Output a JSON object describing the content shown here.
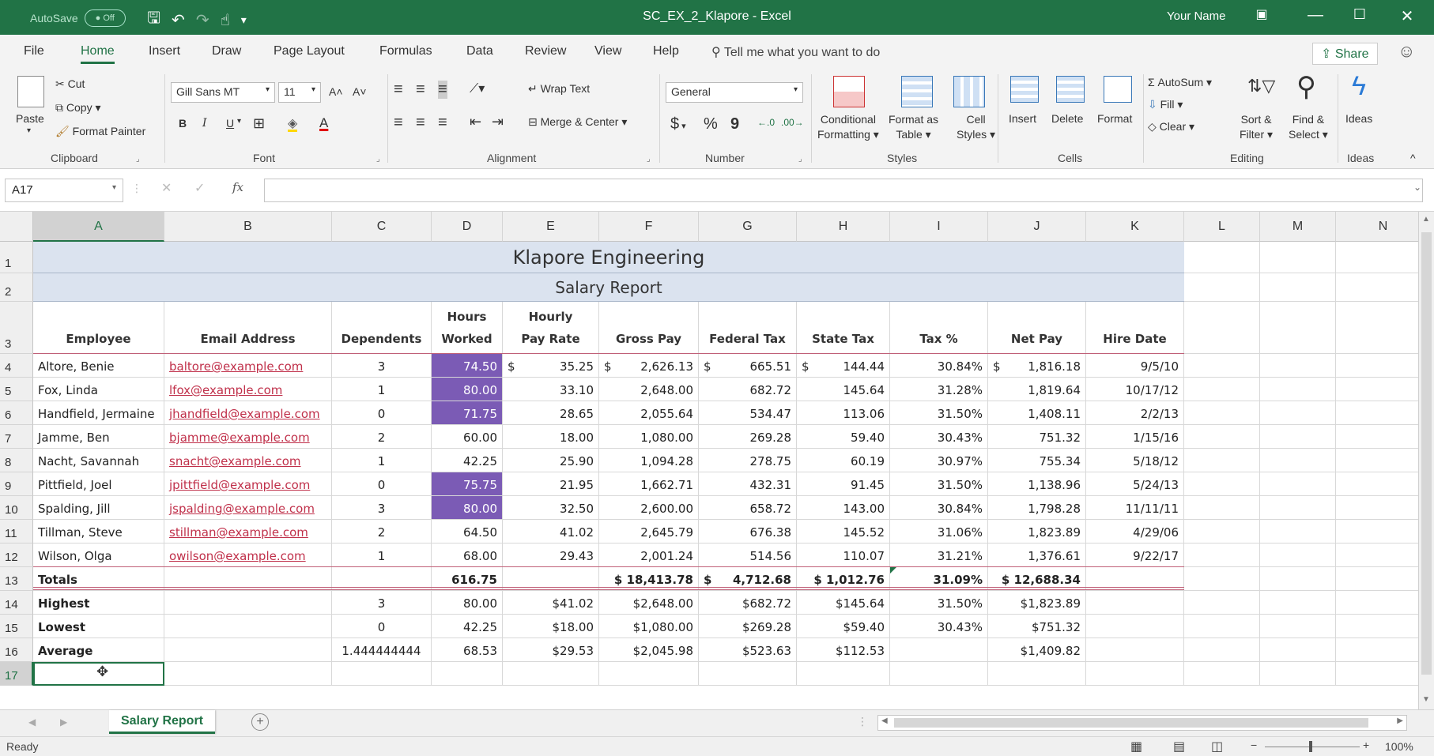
{
  "window": {
    "autosave_label": "AutoSave",
    "autosave_state": "Off",
    "title": "SC_EX_2_Klapore - Excel",
    "user": "Your Name"
  },
  "menu": [
    "File",
    "Home",
    "Insert",
    "Draw",
    "Page Layout",
    "Formulas",
    "Data",
    "Review",
    "View",
    "Help"
  ],
  "tell_me": "Tell me what you want to do",
  "share": "Share",
  "ribbon": {
    "clipboard": {
      "paste": "Paste",
      "cut": "Cut",
      "copy": "Copy",
      "format_painter": "Format Painter",
      "group": "Clipboard"
    },
    "font": {
      "name": "Gill Sans MT",
      "size": "11",
      "group": "Font",
      "bold": "B",
      "italic": "I",
      "underline": "U"
    },
    "alignment": {
      "wrap": "Wrap Text",
      "merge": "Merge & Center",
      "group": "Alignment"
    },
    "number": {
      "format": "General",
      "group": "Number",
      "dollar": "$",
      "percent": "%",
      "comma": "9"
    },
    "styles": {
      "conditional": "Conditional",
      "formatting": "Formatting",
      "format_as": "Format as",
      "table": "Table",
      "cell": "Cell",
      "cell_styles": "Styles",
      "group": "Styles"
    },
    "cells": {
      "insert": "Insert",
      "delete": "Delete",
      "format": "Format",
      "group": "Cells"
    },
    "editing": {
      "autosum": "AutoSum",
      "fill": "Fill",
      "clear": "Clear",
      "sort": "Sort &",
      "filter": "Filter",
      "find": "Find &",
      "select": "Select",
      "group": "Editing"
    },
    "ideas": {
      "label": "Ideas",
      "group": "Ideas"
    }
  },
  "namebox": "A17",
  "fx": "fx",
  "columns": [
    "A",
    "B",
    "C",
    "D",
    "E",
    "F",
    "G",
    "H",
    "I",
    "J",
    "K",
    "L",
    "M",
    "N"
  ],
  "rows": [
    "1",
    "2",
    "3",
    "4",
    "5",
    "6",
    "7",
    "8",
    "9",
    "10",
    "11",
    "12",
    "13",
    "14",
    "15",
    "16",
    "17"
  ],
  "sheet": {
    "title": "Klapore Engineering",
    "subtitle": "Salary Report",
    "headers": [
      [
        "Employee"
      ],
      [
        "Email Address"
      ],
      [
        "Dependents"
      ],
      [
        "Hours",
        "Worked"
      ],
      [
        "Hourly",
        "Pay Rate"
      ],
      [
        "Gross Pay"
      ],
      [
        "Federal Tax"
      ],
      [
        "State Tax"
      ],
      [
        "Tax %"
      ],
      [
        "Net Pay"
      ],
      [
        "Hire Date"
      ]
    ],
    "employees": [
      {
        "name": "Altore, Benie",
        "email": "baltore@example.com",
        "dep": "3",
        "hours": "74.50",
        "rate": "35.25",
        "gross": "2,626.13",
        "fed": "665.51",
        "state": "144.44",
        "taxpct": "30.84%",
        "net": "1,816.18",
        "hire": "9/5/10",
        "hi": true,
        "dollar": true
      },
      {
        "name": "Fox, Linda",
        "email": "lfox@example.com",
        "dep": "1",
        "hours": "80.00",
        "rate": "33.10",
        "gross": "2,648.00",
        "fed": "682.72",
        "state": "145.64",
        "taxpct": "31.28%",
        "net": "1,819.64",
        "hire": "10/17/12",
        "hi": true
      },
      {
        "name": "Handfield, Jermaine",
        "email": "jhandfield@example.com",
        "dep": "0",
        "hours": "71.75",
        "rate": "28.65",
        "gross": "2,055.64",
        "fed": "534.47",
        "state": "113.06",
        "taxpct": "31.50%",
        "net": "1,408.11",
        "hire": "2/2/13",
        "hi": true
      },
      {
        "name": "Jamme, Ben",
        "email": "bjamme@example.com",
        "dep": "2",
        "hours": "60.00",
        "rate": "18.00",
        "gross": "1,080.00",
        "fed": "269.28",
        "state": "59.40",
        "taxpct": "30.43%",
        "net": "751.32",
        "hire": "1/15/16",
        "hi": false
      },
      {
        "name": "Nacht, Savannah",
        "email": "snacht@example.com",
        "dep": "1",
        "hours": "42.25",
        "rate": "25.90",
        "gross": "1,094.28",
        "fed": "278.75",
        "state": "60.19",
        "taxpct": "30.97%",
        "net": "755.34",
        "hire": "5/18/12",
        "hi": false
      },
      {
        "name": "Pittfield, Joel",
        "email": "jpittfield@example.com",
        "dep": "0",
        "hours": "75.75",
        "rate": "21.95",
        "gross": "1,662.71",
        "fed": "432.31",
        "state": "91.45",
        "taxpct": "31.50%",
        "net": "1,138.96",
        "hire": "5/24/13",
        "hi": true
      },
      {
        "name": "Spalding, Jill",
        "email": "jspalding@example.com",
        "dep": "3",
        "hours": "80.00",
        "rate": "32.50",
        "gross": "2,600.00",
        "fed": "658.72",
        "state": "143.00",
        "taxpct": "30.84%",
        "net": "1,798.28",
        "hire": "11/11/11",
        "hi": true
      },
      {
        "name": "Tillman, Steve",
        "email": "stillman@example.com",
        "dep": "2",
        "hours": "64.50",
        "rate": "41.02",
        "gross": "2,645.79",
        "fed": "676.38",
        "state": "145.52",
        "taxpct": "31.06%",
        "net": "1,823.89",
        "hire": "4/29/06",
        "hi": false
      },
      {
        "name": "Wilson, Olga",
        "email": "owilson@example.com",
        "dep": "1",
        "hours": "68.00",
        "rate": "29.43",
        "gross": "2,001.24",
        "fed": "514.56",
        "state": "110.07",
        "taxpct": "31.21%",
        "net": "1,376.61",
        "hire": "9/22/17",
        "hi": false
      }
    ],
    "dollar_sign": "$",
    "totals": {
      "label": "Totals",
      "hours": "616.75",
      "gross": "$ 18,413.78",
      "fed": "4,712.68",
      "state": "$ 1,012.76",
      "taxpct": "31.09%",
      "net": "$ 12,688.34"
    },
    "highest": {
      "label": "Highest",
      "dep": "3",
      "hours": "80.00",
      "rate": "$41.02",
      "gross": "$2,648.00",
      "fed": "$682.72",
      "state": "$145.64",
      "taxpct": "31.50%",
      "net": "$1,823.89"
    },
    "lowest": {
      "label": "Lowest",
      "dep": "0",
      "hours": "42.25",
      "rate": "$18.00",
      "gross": "$1,080.00",
      "fed": "$269.28",
      "state": "$59.40",
      "taxpct": "30.43%",
      "net": "$751.32"
    },
    "average": {
      "label": "Average",
      "dep": "1.444444444",
      "hours": "68.53",
      "rate": "$29.53",
      "gross": "$2,045.98",
      "fed": "$523.63",
      "state": "$112.53",
      "taxpct": "",
      "net": "$1,409.82"
    }
  },
  "sheet_tab": "Salary Report",
  "status": {
    "ready": "Ready",
    "zoom": "100%"
  },
  "colors": {
    "excel_green": "#217346",
    "highlight": "#7b5bb5",
    "banner": "#dbe3ef",
    "link": "#c0304a"
  }
}
